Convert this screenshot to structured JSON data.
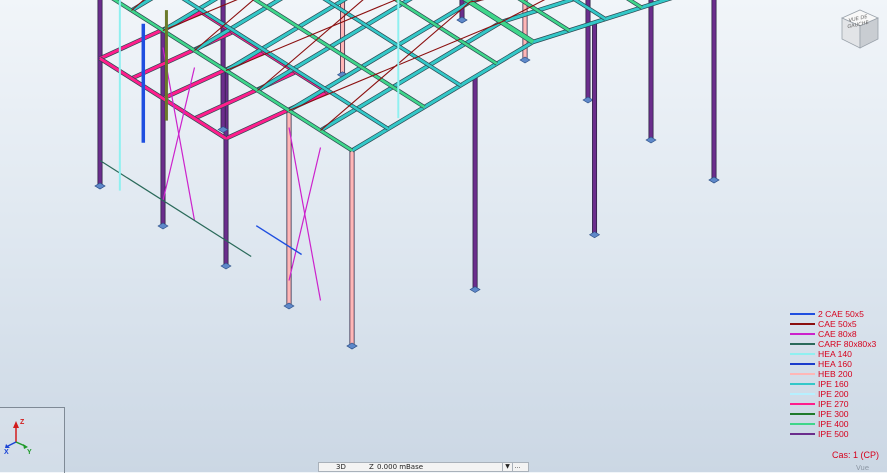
{
  "app": {
    "view_cube": {
      "icon": "view-cube-icon",
      "label": "VUE DE GAUCHE"
    },
    "view_sub_label": "Vue"
  },
  "legend": {
    "items": [
      {
        "label": "2 CAE 50x5",
        "color": "#1f4fe0"
      },
      {
        "label": "CAE 50x5",
        "color": "#8b0f0f"
      },
      {
        "label": "CAE 80x8",
        "color": "#cc22cc"
      },
      {
        "label": "CARF 80x80x3",
        "color": "#2a6a5a"
      },
      {
        "label": "HEA 140",
        "color": "#8ff0f0"
      },
      {
        "label": "HEA 160",
        "color": "#1a3acc"
      },
      {
        "label": "HEB 200",
        "color": "#ffb6b6"
      },
      {
        "label": "IPE 160",
        "color": "#33c8c8"
      },
      {
        "label": "IPE 200",
        "color": "#b6f0ff"
      },
      {
        "label": "IPE 270",
        "color": "#ff1e8c"
      },
      {
        "label": "IPE 300",
        "color": "#1f7a2a"
      },
      {
        "label": "IPE 400",
        "color": "#3fd68a"
      },
      {
        "label": "IPE 500",
        "color": "#6b2d8c"
      }
    ],
    "load_case": "Cas: 1 (CP)"
  },
  "axis": {
    "x": "X",
    "y": "Y",
    "z": "Z"
  },
  "bottom_bar": {
    "view_mode": "3D",
    "plane_axis": "Z",
    "plane_value": "0.000 m",
    "plane_name": "Base",
    "dropdown_icon": "chevron-down-icon",
    "extra_icon": "select-icon"
  }
}
